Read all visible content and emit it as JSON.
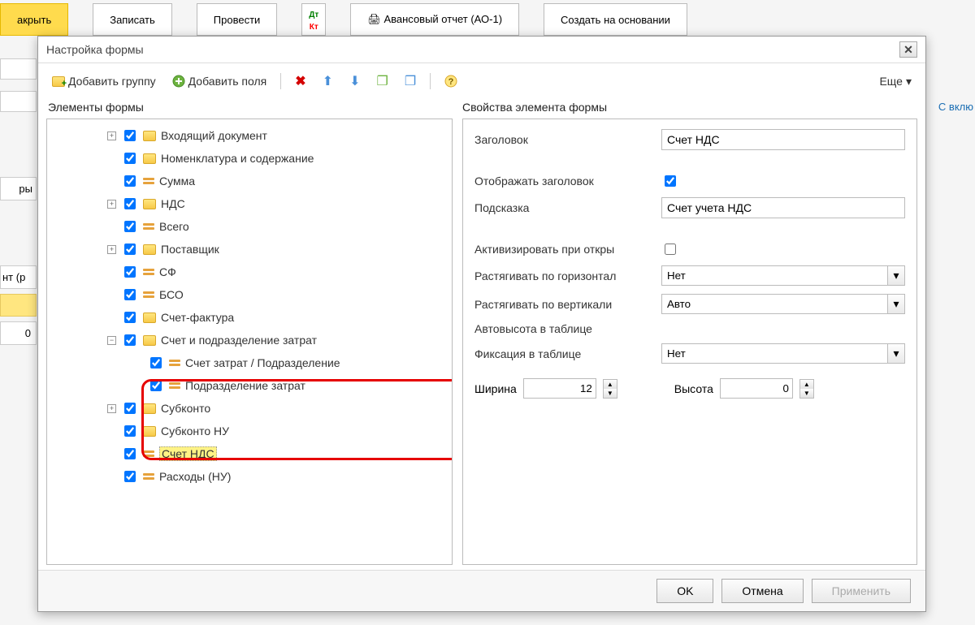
{
  "bg": {
    "close": "акрыть",
    "write": "Записать",
    "post": "Провести",
    "report": "Авансовый отчет (АО-1)",
    "create_based": "Создать на основании",
    "link": "С вклю",
    "side1": "ры",
    "side2": "нт (р",
    "side3": "0"
  },
  "modal": {
    "title": "Настройка формы",
    "toolbar": {
      "add_group": "Добавить группу",
      "add_fields": "Добавить поля",
      "more": "Еще"
    },
    "section_left": "Элементы формы",
    "section_right": "Свойства элемента формы",
    "footer": {
      "ok": "OK",
      "cancel": "Отмена",
      "apply": "Применить"
    }
  },
  "tree": {
    "items": [
      {
        "exp": "+",
        "type": "folder",
        "label": "Входящий документ"
      },
      {
        "exp": "",
        "type": "folder",
        "label": "Номенклатура и содержание"
      },
      {
        "exp": "",
        "type": "leaf",
        "label": "Сумма"
      },
      {
        "exp": "+",
        "type": "folder",
        "label": "НДС"
      },
      {
        "exp": "",
        "type": "leaf",
        "label": "Всего"
      },
      {
        "exp": "+",
        "type": "folder",
        "label": "Поставщик"
      },
      {
        "exp": "",
        "type": "leaf",
        "label": "СФ"
      },
      {
        "exp": "",
        "type": "leaf",
        "label": "БСО"
      },
      {
        "exp": "",
        "type": "folder",
        "label": "Счет-фактура"
      },
      {
        "exp": "-",
        "type": "folder",
        "label": "Счет и подразделение затрат"
      },
      {
        "exp": "",
        "type": "leaf",
        "label": "Счет затрат / Подразделение",
        "child": true
      },
      {
        "exp": "",
        "type": "leaf",
        "label": "Подразделение затрат",
        "child": true
      },
      {
        "exp": "+",
        "type": "folder",
        "label": "Субконто"
      },
      {
        "exp": "",
        "type": "folder",
        "label": "Субконто НУ"
      },
      {
        "exp": "",
        "type": "leaf",
        "label": "Счет НДС",
        "selected": true
      },
      {
        "exp": "",
        "type": "leaf",
        "label": "Расходы (НУ)"
      }
    ]
  },
  "props": {
    "title_label": "Заголовок",
    "title_value": "Счет НДС",
    "show_title": "Отображать заголовок",
    "hint_label": "Подсказка",
    "hint_value": "Счет учета НДС",
    "activate": "Активизировать при откры",
    "stretch_h": "Растягивать по горизонтал",
    "stretch_h_val": "Нет",
    "stretch_v": "Растягивать по вертикали",
    "stretch_v_val": "Авто",
    "autoheight": "Автовысота в таблице",
    "fixation": "Фиксация в таблице",
    "fixation_val": "Нет",
    "width_label": "Ширина",
    "width_val": "12",
    "height_label": "Высота",
    "height_val": "0"
  }
}
